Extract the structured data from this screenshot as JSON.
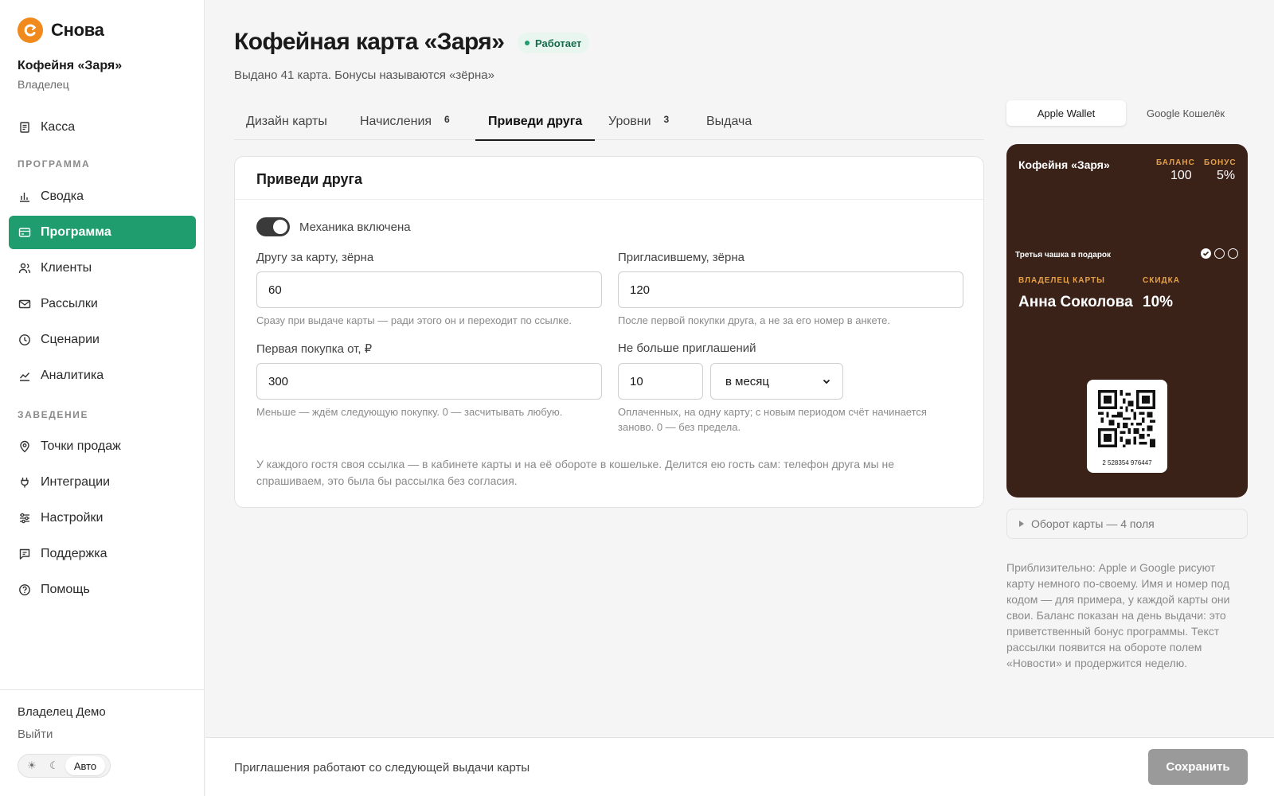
{
  "brand": {
    "name": "Снова"
  },
  "org": {
    "name": "Кофейня «Заря»",
    "role": "Владелец"
  },
  "nav": {
    "kassa": "Касса",
    "section_program": "ПРОГРАММА",
    "summary": "Сводка",
    "program": "Программа",
    "clients": "Клиенты",
    "mailings": "Рассылки",
    "scenarios": "Сценарии",
    "analytics": "Аналитика",
    "section_venue": "ЗАВЕДЕНИЕ",
    "points": "Точки продаж",
    "integrations": "Интеграции",
    "settings": "Настройки",
    "support": "Поддержка",
    "help": "Помощь"
  },
  "user": {
    "name": "Владелец Демо",
    "logout": "Выйти"
  },
  "theme": {
    "sun": "☀",
    "moon": "☾",
    "auto": "Авто"
  },
  "header": {
    "title": "Кофейная карта «Заря»",
    "status": "Работает",
    "subtitle": "Выдано 41 карта. Бонусы называются «зёрна»"
  },
  "tabs": [
    {
      "label": "Дизайн карты",
      "count": ""
    },
    {
      "label": "Начисления",
      "count": "6"
    },
    {
      "label": "Приведи друга",
      "count": ""
    },
    {
      "label": "Уровни",
      "count": "3"
    },
    {
      "label": "Выдача",
      "count": ""
    }
  ],
  "panel": {
    "title": "Приведи друга",
    "toggle_label": "Механика включена",
    "friend_label": "Другу за карту, зёрна",
    "friend_value": "60",
    "friend_hint": "Сразу при выдаче карты — ради этого он и переходит по ссылке.",
    "inviter_label": "Пригласившему, зёрна",
    "inviter_value": "120",
    "inviter_hint": "После первой покупки друга, а не за его номер в анкете.",
    "purchase_label": "Первая покупка от, ₽",
    "purchase_value": "300",
    "purchase_hint": "Меньше — ждём следующую покупку. 0 — засчитывать любую.",
    "limit_label": "Не больше приглашений",
    "limit_value": "10",
    "period_value": "в месяц",
    "limit_hint": "Оплаченных, на одну карту; с новым периодом счёт начинается заново. 0 — без предела.",
    "note": "У каждого гостя своя ссылка — в кабинете карты и на её обороте в кошельке. Делится ею гость сам: телефон друга мы не спрашиваем, это была бы рассылка без согласия."
  },
  "wallet": {
    "apple": "Apple Wallet",
    "google": "Google Кошелёк"
  },
  "card": {
    "org": "Кофейня «Заря»",
    "balance_label": "БАЛАНС",
    "balance_value": "100",
    "bonus_label": "БОНУС",
    "bonus_value": "5%",
    "promo": "Третья чашка в подарок",
    "holder_label": "ВЛАДЕЛЕЦ КАРТЫ",
    "holder_value": "Анна Соколова",
    "discount_label": "СКИДКА",
    "discount_value": "10%",
    "code_number": "2 528354 976447",
    "stamps_total": 3,
    "stamps_filled": 1
  },
  "card_back": {
    "label": "Оборот карты — 4 поля"
  },
  "side_note": "Приблизительно: Apple и Google рисуют карту немного по-своему. Имя и номер под кодом — для примера, у каждой карты они свои. Баланс показан на день выдачи: это приветственный бонус программы. Текст рассылки появится на обороте полем «Новости» и продержится неделю.",
  "footer": {
    "text": "Приглашения работают со следующей выдачи карты",
    "save": "Сохранить"
  },
  "colors": {
    "accent": "#1f9d6e",
    "brand": "#f08a1c",
    "card_bg": "#3a2219",
    "card_label": "#e5a04a"
  }
}
